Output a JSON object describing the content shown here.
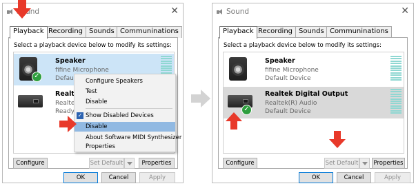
{
  "colors": {
    "accent_red": "#e8392a",
    "selection_blue": "#cce4f7",
    "selection_gray": "#d9d9d9",
    "level_teal": "#8fd7d2",
    "menu_highlight": "#91b9e2",
    "check_green": "#2e9e3e"
  },
  "left": {
    "title": "Sound",
    "close_icon": "✕",
    "tabs": [
      "Playback",
      "Recording",
      "Sounds",
      "Communinations"
    ],
    "instruction": "Select a playback device below to modify its settings:",
    "devices": [
      {
        "name": "Speaker",
        "sub": "fifine Microphone",
        "status": "Default Device"
      },
      {
        "name": "Realte",
        "sub": "Realte",
        "status": "Ready"
      }
    ],
    "context_menu": {
      "items": [
        "Configure Speakers",
        "Test",
        "Disable",
        "Show Disabled Devices",
        "Disable",
        "About Software MIDI Synthesizer",
        "Properties"
      ]
    },
    "buttons": {
      "configure": "Configure",
      "set_default": "Set Default",
      "properties": "Properties",
      "ok": "OK",
      "cancel": "Cancel",
      "apply": "Apply"
    }
  },
  "right": {
    "title": "Sound",
    "close_icon": "✕",
    "tabs": [
      "Playback",
      "Recording",
      "Sounds",
      "Communinations"
    ],
    "instruction": "Select a playback device below to modify its settings:",
    "devices": [
      {
        "name": "Speaker",
        "sub": "fifine Microphone",
        "status": "Default Device"
      },
      {
        "name": "Realtek Digital Output",
        "sub": "Realtek(R) Audio",
        "status": "Default Device"
      }
    ],
    "buttons": {
      "configure": "Configure",
      "set_default": "Set Default",
      "properties": "Properties",
      "ok": "OK",
      "cancel": "Cancel",
      "apply": "Apply"
    }
  }
}
